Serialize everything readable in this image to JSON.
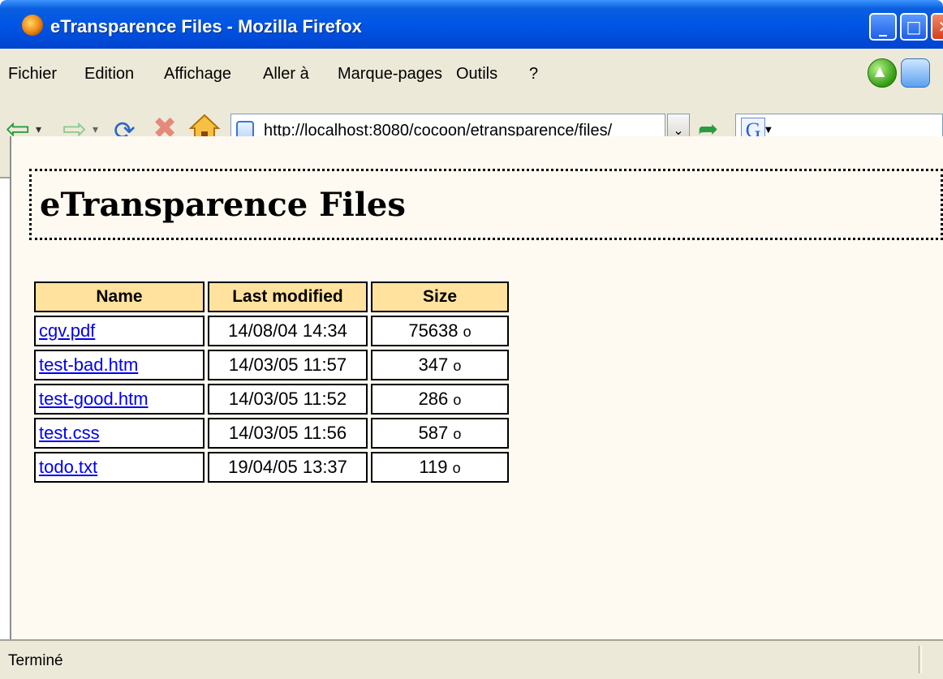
{
  "window": {
    "title": "eTransparence Files - Mozilla Firefox",
    "controls": [
      "minimize",
      "maximize",
      "close"
    ]
  },
  "menubar": {
    "items": [
      {
        "label": "Fichier",
        "accesskey": "F"
      },
      {
        "label": "Edition",
        "accesskey": "E"
      },
      {
        "label": "Affichage",
        "accesskey": "A"
      },
      {
        "label": "Aller à",
        "accesskey": "l"
      },
      {
        "label": "Marque-pages",
        "accesskey": "M"
      },
      {
        "label": "Outils",
        "accesskey": "t"
      },
      {
        "label": "?",
        "accesskey": "?"
      }
    ]
  },
  "navbar": {
    "url": "http://localhost:8080/cocoon/etransparence/files/",
    "icons": [
      "back-arrow-icon",
      "forward-arrow-icon",
      "reload-icon",
      "stop-icon",
      "home-icon",
      "go-arrow-icon",
      "google-search-icon"
    ]
  },
  "page": {
    "heading": "eTransparence Files",
    "table": {
      "headers": [
        "Name",
        "Last modified",
        "Size"
      ],
      "rows": [
        {
          "name": "cgv.pdf",
          "modified": "14/08/04 14:34",
          "size": "75638",
          "unit": "o"
        },
        {
          "name": "test-bad.htm",
          "modified": "14/03/05 11:57",
          "size": "347",
          "unit": "o"
        },
        {
          "name": "test-good.htm",
          "modified": "14/03/05 11:52",
          "size": "286",
          "unit": "o"
        },
        {
          "name": "test.css",
          "modified": "14/03/05 11:56",
          "size": "587",
          "unit": "o"
        },
        {
          "name": "todo.txt",
          "modified": "19/04/05 13:37",
          "size": "119",
          "unit": "o"
        }
      ]
    }
  },
  "status": {
    "text": "Terminé"
  },
  "colors": {
    "title_bar": "#0055e5",
    "header_cell": "#ffe29e",
    "content_bg": "#fffaf1",
    "link": "#0000ee"
  }
}
